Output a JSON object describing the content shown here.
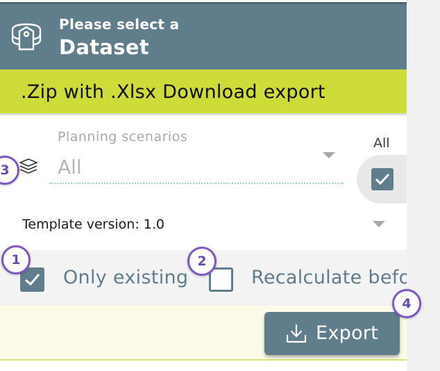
{
  "header": {
    "subtitle": "Please select a",
    "title": "Dataset",
    "icon": "dataset-icon"
  },
  "banner": {
    "text": ".Zip with .Xlsx Download export"
  },
  "scenarios": {
    "label": "Planning scenarios",
    "value": "All",
    "icon": "layers-icon",
    "all_label": "All",
    "all_checked": true
  },
  "template": {
    "version_text": "Template version: 1.0"
  },
  "options": {
    "only_existing_label": "Only existing",
    "only_existing_checked": true,
    "recalculate_label": "Recalculate befo",
    "recalculate_checked": false
  },
  "export": {
    "label": "Export",
    "icon": "download-icon"
  },
  "badges": {
    "one": "1",
    "two": "2",
    "three": "3",
    "four": "4"
  },
  "colors": {
    "primary": "#607d8b",
    "accent": "#cddc39",
    "badge": "#7e57c2"
  }
}
